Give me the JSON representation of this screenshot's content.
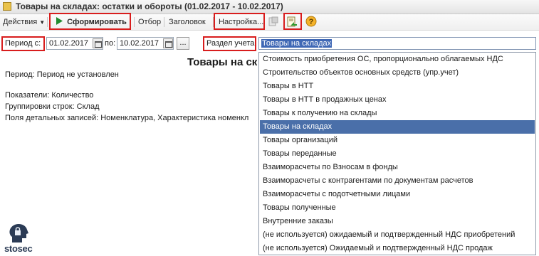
{
  "window": {
    "title": "Товары на складах: остатки и обороты (01.02.2017 - 10.02.2017)"
  },
  "toolbar": {
    "actions_label": "Действия",
    "generate_label": "Сформировать",
    "filter_label": "Отбор",
    "header_label": "Заголовок",
    "settings_label": "Настройка..."
  },
  "params": {
    "period_from_label": "Период с:",
    "date_from": "01.02.2017",
    "to_label": "по:",
    "date_to": "10.02.2017",
    "more_button": "...",
    "section_label": "Раздел учета:",
    "section_value": "Товары на складах"
  },
  "report": {
    "title": "Товары на ск",
    "period_line": "Период: Период не установлен",
    "indicators_line": "Показатели:  Количество",
    "grouping_line": "Группировки строк: Склад",
    "detail_line": "Поля детальных записей:  Номенклатура, Характеристика номенкл"
  },
  "dropdown": {
    "items": [
      "Стоимость приобретения ОС, пропорционально облагаемых НДС",
      "Строительство объектов основных средств (упр.учет)",
      "Товары в НТТ",
      "Товары в НТТ в продажных ценах",
      "Товары к получению на склады",
      "Товары на складах",
      "Товары организаций",
      "Товары переданные",
      "Взаиморасчеты по Взносам в фонды",
      "Взаиморасчеты с контрагентами по документам расчетов",
      "Взаиморасчеты с подотчетными лицами",
      "Товары полученные",
      "Внутренние заказы",
      "(не используется)  ожидаемый и подтвержденный НДС приобретений",
      "(не используется) Ожидаемый и подтвержденный НДС продаж"
    ],
    "selected_index": 5
  },
  "logo": {
    "text": "stosec"
  },
  "colors": {
    "highlight": "#d81d1d",
    "selection": "#4a6fa9",
    "play": "#1e8c2e"
  }
}
